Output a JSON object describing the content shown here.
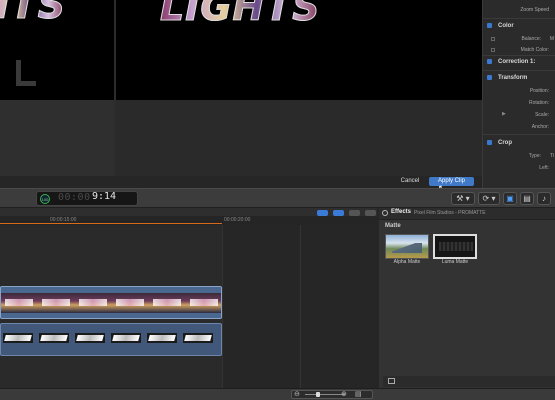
{
  "viewer": {
    "left_title_art": "HTS",
    "right_title_art": "LIGHTS"
  },
  "apply_bar": {
    "cancel_label": "Cancel",
    "apply_label": "Apply Clip"
  },
  "inspector": {
    "zoom_speed_label": "Zoom Speed",
    "sections": {
      "color": "Color",
      "correction": "Correction 1:",
      "transform": "Transform",
      "crop": "Crop"
    },
    "rows": {
      "balance": "Balance:",
      "balance_value": "M",
      "match_color": "Match Color:",
      "position": "Position:",
      "rotation": "Rotation:",
      "scale": "Scale:",
      "anchor": "Anchor:",
      "type": "Type:",
      "type_value": "Ti",
      "left": "Left:"
    }
  },
  "toolbar": {
    "timecode_badge": "100",
    "timecode_dim": "00:00",
    "timecode_value": "9:14"
  },
  "timeline": {
    "ruler_labels": [
      "00:00:15:00",
      "00:00:20:00"
    ]
  },
  "effects": {
    "title": "Effects",
    "source": "Pixel Film Studios - PROMATTE",
    "category": "Matte",
    "items": [
      {
        "label": "Alpha Matte"
      },
      {
        "label": "Luma Matte"
      }
    ]
  },
  "colors": {
    "accent": "#3f79c8",
    "playhead": "#d86a1c",
    "clip_blue": "#4a6790"
  }
}
